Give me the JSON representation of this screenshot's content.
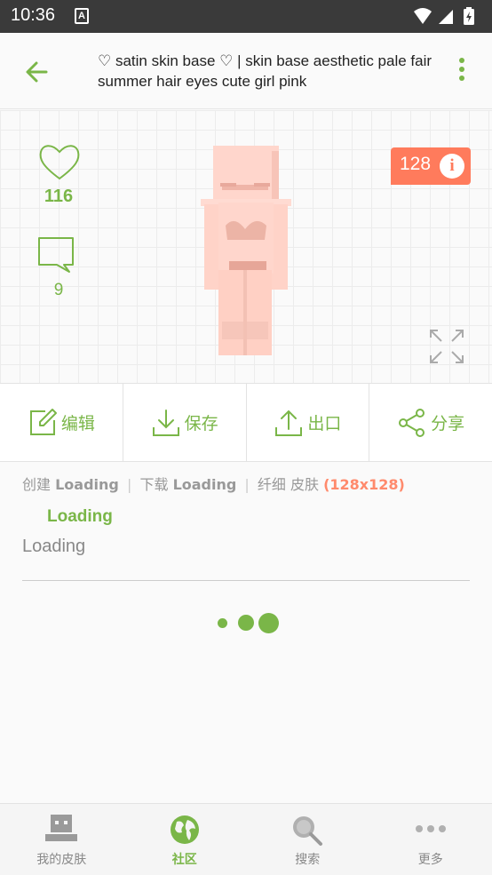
{
  "status_bar": {
    "time": "10:36",
    "notification_glyph": "A"
  },
  "app_bar": {
    "title": "♡ satin skin base ♡ | skin base aesthetic pale fair summer hair eyes cute girl pink"
  },
  "preview": {
    "likes": "116",
    "comments": "9",
    "resolution": "128",
    "info_glyph": "i"
  },
  "actions": [
    {
      "label": "编辑",
      "icon": "edit-icon"
    },
    {
      "label": "保存",
      "icon": "download-icon"
    },
    {
      "label": "出口",
      "icon": "upload-icon"
    },
    {
      "label": "分享",
      "icon": "share-icon"
    }
  ],
  "meta": {
    "created_label": "创建",
    "created_value": "Loading",
    "downloads_label": "下载",
    "downloads_value": "Loading",
    "type_label": "纤细 皮肤",
    "resolution_text": "(128x128)"
  },
  "author": "Loading",
  "description": "Loading",
  "bottom_nav": [
    {
      "label": "我的皮肤",
      "icon": "my-skins-icon",
      "active": false
    },
    {
      "label": "社区",
      "icon": "globe-icon",
      "active": true
    },
    {
      "label": "搜索",
      "icon": "search-icon",
      "active": false
    },
    {
      "label": "更多",
      "icon": "more-dots-icon",
      "active": false
    }
  ],
  "colors": {
    "accent": "#7ab648",
    "badge": "#ff7b5c",
    "status_bar": "#3a3a3a"
  }
}
